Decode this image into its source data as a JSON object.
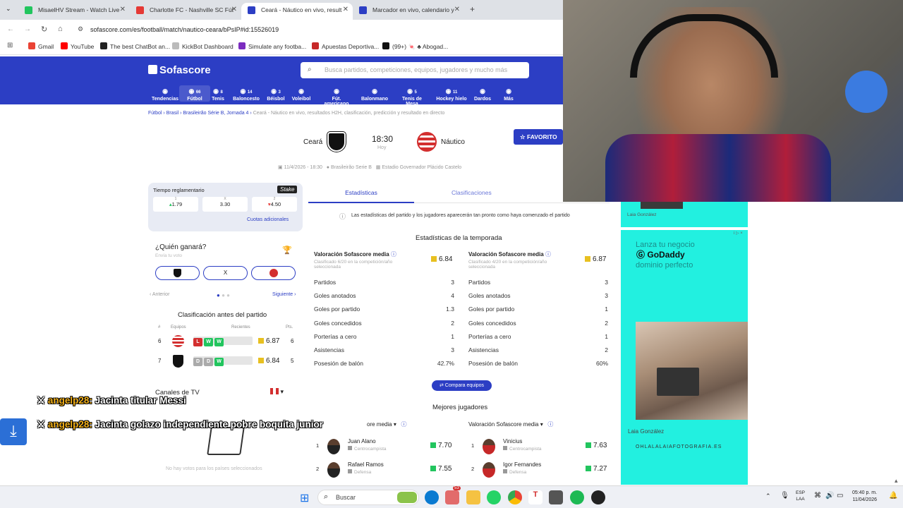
{
  "browser": {
    "tabs": [
      {
        "title": "MisaelHV Stream - Watch Live",
        "color": "#22c55e"
      },
      {
        "title": "Charlotte FC - Nashville SC Fút",
        "color": "#e53935"
      },
      {
        "title": "Ceará - Náutico en vivo, result",
        "color": "#2c3ec4"
      },
      {
        "title": "Marcador en vivo, calendario y",
        "color": "#2c3ec4"
      }
    ],
    "url": "sofascore.com/es/football/match/nautico-ceara/bPsIP#id:15526019",
    "bookmarks": [
      {
        "label": "Gmail",
        "color": "#ea4335"
      },
      {
        "label": "YouTube",
        "color": "#ff0000"
      },
      {
        "label": "The best ChatBot an...",
        "color": "#222"
      },
      {
        "label": "KickBot Dashboard",
        "color": "#999"
      },
      {
        "label": "Simulate any footba...",
        "color": "#7b2cbf"
      },
      {
        "label": "Apuestas Deportiva...",
        "color": "#c62828"
      },
      {
        "label": "(99+) 🍬 ♣ Abogad...",
        "color": "#111"
      }
    ]
  },
  "sofa": {
    "logo": "Sofascore",
    "search_placeholder": "Busca partidos, competiciones, equipos, jugadores y mucho más",
    "nav": [
      {
        "label": "Tendencias",
        "count": ""
      },
      {
        "label": "Fútbol",
        "count": "66"
      },
      {
        "label": "Tenis",
        "count": "8"
      },
      {
        "label": "Baloncesto",
        "count": "14"
      },
      {
        "label": "Béisbol",
        "count": "3"
      },
      {
        "label": "Voleibol",
        "count": ""
      },
      {
        "label": "Fút. americano",
        "count": ""
      },
      {
        "label": "Balonmano",
        "count": ""
      },
      {
        "label": "Tenis de Mesa",
        "count": "5"
      },
      {
        "label": "Hockey hielo",
        "count": "11"
      },
      {
        "label": "Dardos",
        "count": ""
      },
      {
        "label": "Más",
        "count": ""
      }
    ],
    "breadcrumb": {
      "b1": "Fútbol",
      "b2": "Brasil",
      "b3": "Brasileirão Série B, Jornada 4",
      "current": "Ceará - Náutico en vivo, resultados H2H, clasificación, predicción y resultado en directo"
    },
    "match": {
      "home": "Ceará",
      "away": "Náutico",
      "time": "18:30",
      "day": "Hoy",
      "favorite": "FAVORITO",
      "date": "11/4/2026 - 18:30",
      "league": "Brasileirão Serie B",
      "stadium": "Estadio Governador Plácido Castelo"
    },
    "odds": {
      "title": "Tiempo reglamentario",
      "brand": "Stake",
      "h_lab": "1",
      "d_lab": "X",
      "a_lab": "2",
      "home": "1.79",
      "draw": "3.30",
      "away": "4.50",
      "more": "Cuotas adicionales"
    },
    "vote": {
      "title": "¿Quién ganará?",
      "subtitle": "Envía tu voto",
      "draw": "X",
      "prev": "Anterior",
      "next": "Siguiente"
    },
    "standings": {
      "title": "Clasificación antes del partido",
      "col_rank": "#",
      "col_team": "Equipos",
      "col_recent": "Recientes",
      "col_pts": "Pts.",
      "rows": [
        {
          "pos": "6",
          "form": [
            "L",
            "W",
            "W"
          ],
          "rating": "6.87",
          "pts": "6"
        },
        {
          "pos": "7",
          "form": [
            "D",
            "D",
            "W"
          ],
          "rating": "6.84",
          "pts": "5"
        }
      ]
    },
    "tv": {
      "title": "Canales de TV",
      "empty": "No hay votos para los países seleccionados"
    },
    "tabs": {
      "stats": "Estadísticas",
      "standings": "Clasificaciones"
    },
    "notice": "Las estadísticas del partido y los jugadores aparecerán tan pronto como haya comenzado el partido",
    "season": {
      "title": "Estadísticas de la temporada",
      "rating_label": "Valoración Sofascore media",
      "home_rank": "Clasificado 6/20 en la competición/año seleccionada",
      "away_rank": "Clasificado 4/20 en la competición/año seleccionada",
      "home_rating": "6.84",
      "away_rating": "6.87",
      "stats": [
        {
          "label": "Partidos",
          "home": "3",
          "away": "3"
        },
        {
          "label": "Goles anotados",
          "home": "4",
          "away": "3"
        },
        {
          "label": "Goles por partido",
          "home": "1.3",
          "away": "1"
        },
        {
          "label": "Goles concedidos",
          "home": "2",
          "away": "2"
        },
        {
          "label": "Porterías a cero",
          "home": "1",
          "away": "1"
        },
        {
          "label": "Asistencias",
          "home": "3",
          "away": "2"
        },
        {
          "label": "Posesión de balón",
          "home": "42.7%",
          "away": "60%"
        }
      ],
      "compare": "Compara equipos"
    },
    "best": {
      "title": "Mejores jugadores",
      "sort_left": "ore media",
      "sort_right": "Valoración Sofascore media",
      "left": [
        {
          "rank": "1",
          "name": "Juan Alano",
          "pos": "Centrocampista",
          "rating": "7.70"
        },
        {
          "rank": "2",
          "name": "Rafael Ramos",
          "pos": "Defensa",
          "rating": "7.55"
        }
      ],
      "right": [
        {
          "rank": "1",
          "name": "Vinicius",
          "pos": "Centrocampista",
          "rating": "7.63"
        },
        {
          "rank": "2",
          "name": "Igor Fernandes",
          "pos": "Defensa",
          "rating": "7.27"
        }
      ]
    }
  },
  "ad": {
    "top_name": "Laia González",
    "tag": "i ▷ ×",
    "headline_1": "Lanza tu negocio",
    "headline_2": "dominio perfecto",
    "brand": "GoDaddy",
    "person": "Laia González",
    "site": "OHLALALAIAFOTOGRAFIA.ES",
    "bg": "#22f0e0"
  },
  "chat": [
    {
      "user": "angelp28:",
      "text": "Jacinta titular Messi"
    },
    {
      "user": "angelp28:",
      "text": "Jacinta golazo independiente pobre boquita junior"
    }
  ],
  "taskbar": {
    "search": "Buscar",
    "lang1": "ESP",
    "lang2": "LAA",
    "time": "05:40 p. m.",
    "date": "11/04/2026",
    "badge": "53"
  }
}
